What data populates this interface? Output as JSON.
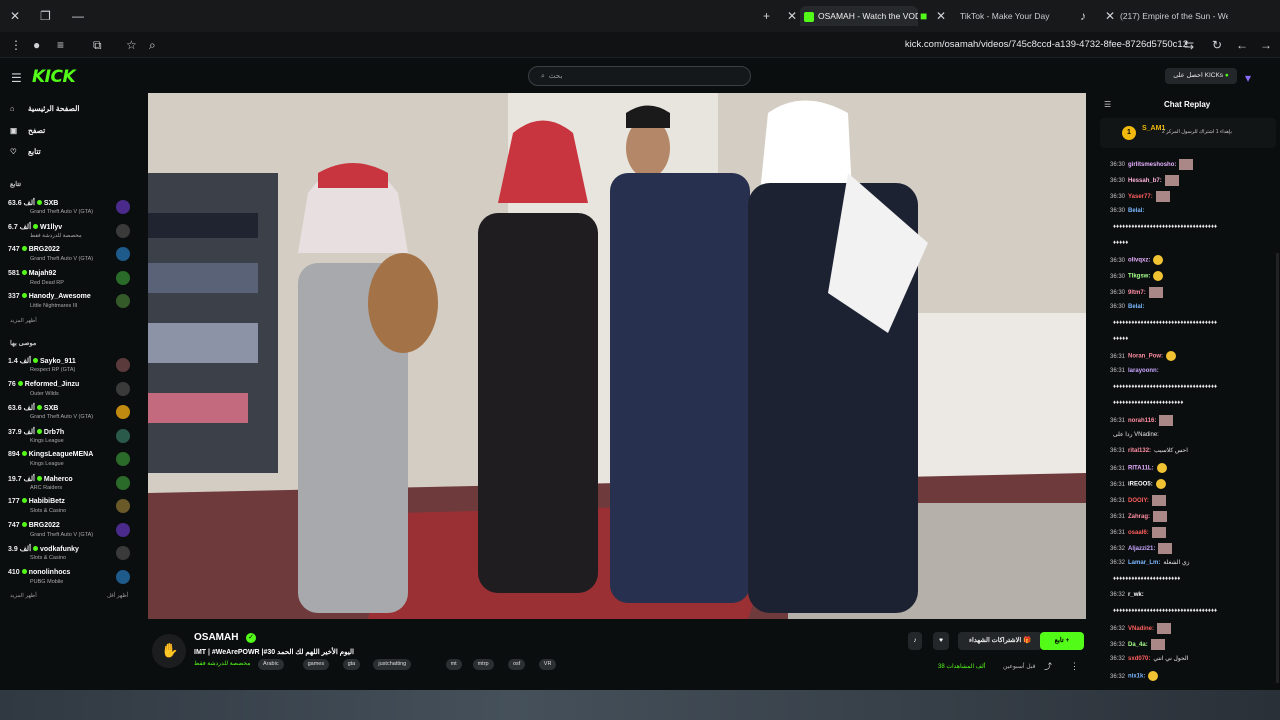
{
  "browser": {
    "tabs": [
      {
        "title": "OSAMAH - Watch the VOD",
        "active": true
      },
      {
        "title": "TikTok - Make Your Day",
        "active": false
      },
      {
        "title": "(217) Empire of the Sun - We",
        "active": false
      }
    ],
    "url": "kick.com/osamah/videos/745c8ccd-a139-4732-8fee-8726d5750c12"
  },
  "kick": {
    "logo": "KICK",
    "search_placeholder": "بحث",
    "kicks_button": "احصل على KICKs"
  },
  "sidebar": {
    "nav": [
      {
        "label": "الصفحة الرئيسية",
        "icon": "home-icon"
      },
      {
        "label": "تصفح",
        "icon": "browse-icon"
      },
      {
        "label": "تتابع",
        "icon": "heart-icon"
      }
    ],
    "following_title": "تتابع",
    "following": [
      {
        "viewers": "63.6 ألف",
        "name": "SXB",
        "game": "Grand Theft Auto V (GTA)"
      },
      {
        "viewers": "6.7 ألف",
        "name": "W1llyv",
        "game": "مخصصة للدردشة فقط"
      },
      {
        "viewers": "747",
        "name": "BRG2022",
        "game": "Grand Theft Auto V (GTA)"
      },
      {
        "viewers": "581",
        "name": "Majah92",
        "game": "Red Dead RP"
      },
      {
        "viewers": "337",
        "name": "Hanody_Awesome",
        "game": "Little Nightmares III"
      }
    ],
    "show_more": "أظهر المزيد",
    "recommended_title": "موصى بها",
    "recommended": [
      {
        "viewers": "1.4 ألف",
        "name": "Sayko_911",
        "game": "Respect RP (GTA)"
      },
      {
        "viewers": "76",
        "name": "Reformed_Jinzu",
        "game": "Outer Wilds"
      },
      {
        "viewers": "63.6 ألف",
        "name": "SXB",
        "game": "Grand Theft Auto V (GTA)"
      },
      {
        "viewers": "37.9 ألف",
        "name": "Drb7h",
        "game": "Kings League"
      },
      {
        "viewers": "894",
        "name": "KingsLeagueMENA",
        "game": "Kings League"
      },
      {
        "viewers": "19.7 ألف",
        "name": "Maherco",
        "game": "ARC Raiders"
      },
      {
        "viewers": "177",
        "name": "HabibiBetz",
        "game": "Slots & Casino"
      },
      {
        "viewers": "747",
        "name": "BRG2022",
        "game": "Grand Theft Auto V (GTA)"
      },
      {
        "viewers": "3.9 ألف",
        "name": "vodkafunky",
        "game": "Slots & Casino"
      },
      {
        "viewers": "410",
        "name": "nonolinhocs",
        "game": "PUBG Mobile"
      }
    ],
    "show_more2": "أظهر المزيد",
    "show_less": "أظهر أقل"
  },
  "stream": {
    "channel": "OSAMAH",
    "title": "IMT | #WeArePOWR |#30 اليوم الأخير اللهم لك الحمد",
    "category": "مخصصة للدردشة فقط",
    "tags": [
      "Arabic",
      "games",
      "gta",
      "justchatting",
      "mt",
      "mtrp",
      "osf",
      "VR"
    ],
    "follow_label": "تابع",
    "subs_label": "الاشتراكات الشهداء",
    "views": "38 ألف المشاهدات",
    "ago": "قبل أسبوعين"
  },
  "chat": {
    "title": "Chat Replay",
    "pinned_user": "S_AM1",
    "pinned_text": "بإهداء 1 اشتراك للرسول المركز 2",
    "messages": [
      {
        "t": "36:30",
        "u": "girlitsmeshosho:",
        "c": "#e6b0ff",
        "e": "emb"
      },
      {
        "t": "36:30",
        "u": "Hessah_b7:",
        "c": "#ffb3d9",
        "e": "emb"
      },
      {
        "t": "36:30",
        "u": "Yaser77:",
        "c": "#ff5e5e",
        "e": "emb"
      },
      {
        "t": "36:30",
        "u": "Belal:",
        "c": "#7ab8ff",
        "e": ""
      },
      {
        "t": "",
        "u": "",
        "c": "#fff",
        "text": "♦♦♦♦♦♦♦♦♦♦♦♦♦♦♦♦♦♦♦♦♦♦♦♦♦♦♦♦♦♦♦♦♦♦"
      },
      {
        "t": "",
        "u": "",
        "c": "#fff",
        "text": "♦♦♦♦♦"
      },
      {
        "t": "36:30",
        "u": "olivqxz:",
        "c": "#e6b0ff",
        "e": "emo"
      },
      {
        "t": "36:30",
        "u": "Tlkgsw:",
        "c": "#a6ff8a",
        "e": "emo"
      },
      {
        "t": "36:30",
        "u": "9ltm7:",
        "c": "#ff8fa3",
        "e": "emb"
      },
      {
        "t": "36:30",
        "u": "Belal:",
        "c": "#7ab8ff",
        "e": ""
      },
      {
        "t": "",
        "u": "",
        "c": "#fff",
        "text": "♦♦♦♦♦♦♦♦♦♦♦♦♦♦♦♦♦♦♦♦♦♦♦♦♦♦♦♦♦♦♦♦♦♦"
      },
      {
        "t": "",
        "u": "",
        "c": "#fff",
        "text": "♦♦♦♦♦"
      },
      {
        "t": "36:31",
        "u": "Noran_Pow:",
        "c": "#ff8fa3",
        "e": "emo"
      },
      {
        "t": "36:31",
        "u": "larayoonn:",
        "c": "#c8a6ff",
        "e": ""
      },
      {
        "t": "",
        "u": "",
        "c": "#fff",
        "text": "♦♦♦♦♦♦♦♦♦♦♦♦♦♦♦♦♦♦♦♦♦♦♦♦♦♦♦♦♦♦♦♦♦♦"
      },
      {
        "t": "",
        "u": "",
        "c": "#fff",
        "text": "♦♦♦♦♦♦♦♦♦♦♦♦♦♦♦♦♦♦♦♦♦♦♦"
      },
      {
        "t": "36:31",
        "u": "norah116:",
        "c": "#ff8fa3",
        "e": "emb"
      },
      {
        "t": "",
        "u": "",
        "c": "#bbb",
        "text": "رداً على VNadine:"
      },
      {
        "t": "36:31",
        "u": "rital132:",
        "c": "#ff8fa3",
        "text": "احس كلاسيب"
      },
      {
        "t": "36:31",
        "u": "RITA11L:",
        "c": "#e6b0ff",
        "e": "emo"
      },
      {
        "t": "36:31",
        "u": "iREOO5:",
        "c": "#fff",
        "e": "emo"
      },
      {
        "t": "36:31",
        "u": "DOOIY:",
        "c": "#ff5e5e",
        "e": "emb"
      },
      {
        "t": "36:31",
        "u": "Zahrag:",
        "c": "#ff8fa3",
        "e": "emb"
      },
      {
        "t": "36:31",
        "u": "osaal6:",
        "c": "#ff5e5e",
        "e": "emb"
      },
      {
        "t": "36:32",
        "u": "Aljazzi21:",
        "c": "#c8a6ff",
        "e": "emb"
      },
      {
        "t": "36:32",
        "u": "Lamar_Lm:",
        "c": "#7ab8ff",
        "text": "زي الشغلة"
      },
      {
        "t": "",
        "u": "",
        "c": "#fff",
        "text": "♦♦♦♦♦♦♦♦♦♦♦♦♦♦♦♦♦♦♦♦♦♦"
      },
      {
        "t": "36:32",
        "u": "r_wk:",
        "c": "#fff",
        "e": ""
      },
      {
        "t": "",
        "u": "",
        "c": "#fff",
        "text": "♦♦♦♦♦♦♦♦♦♦♦♦♦♦♦♦♦♦♦♦♦♦♦♦♦♦♦♦♦♦♦♦♦♦"
      },
      {
        "t": "36:32",
        "u": "VNadine:",
        "c": "#ff5e5e",
        "e": "emb"
      },
      {
        "t": "36:32",
        "u": "Da_4a:",
        "c": "#a6ff8a",
        "e": "emb"
      },
      {
        "t": "36:32",
        "u": "sxd070:",
        "c": "#ff5e5e",
        "text": "الحول ني انتي"
      },
      {
        "t": "36:32",
        "u": "nix1k:",
        "c": "#7ab8ff",
        "e": "emo"
      }
    ]
  },
  "colors": {
    "accent": "#53fc18",
    "bg": "#0b0e0f"
  }
}
